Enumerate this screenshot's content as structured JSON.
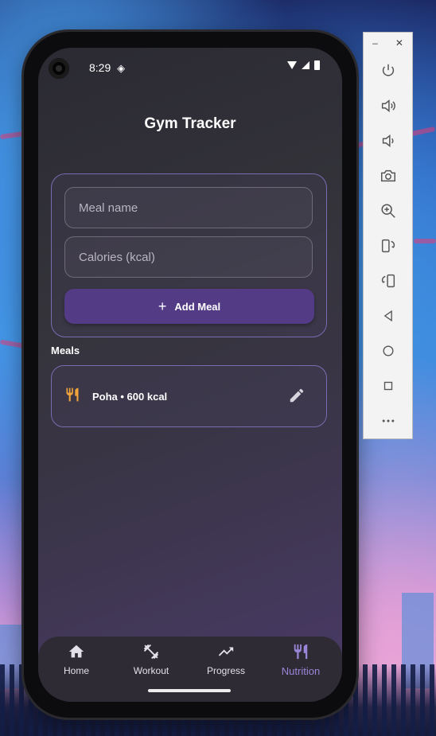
{
  "status_bar": {
    "time": "8:29"
  },
  "app": {
    "title": "Gym Tracker"
  },
  "form": {
    "meal_name_placeholder": "Meal name",
    "calories_placeholder": "Calories (kcal)",
    "add_button_label": "Add Meal"
  },
  "meals": {
    "heading": "Meals",
    "items": [
      {
        "label": "Poha • 600 kcal"
      }
    ]
  },
  "nav": {
    "items": [
      {
        "label": "Home",
        "icon": "home-icon"
      },
      {
        "label": "Workout",
        "icon": "dumbbell-icon"
      },
      {
        "label": "Progress",
        "icon": "trending-up-icon"
      },
      {
        "label": "Nutrition",
        "icon": "restaurant-icon",
        "active": true
      }
    ]
  },
  "emulator_toolbar": {
    "buttons": [
      "power-icon",
      "volume-up-icon",
      "volume-down-icon",
      "camera-icon",
      "zoom-in-icon",
      "rotate-left-icon",
      "rotate-right-icon",
      "back-icon",
      "home-circle-icon",
      "overview-icon",
      "more-icon"
    ]
  },
  "colors": {
    "accent": "#533c85",
    "active_nav": "#9a86d8",
    "meal_icon": "#f0a43a",
    "card_border": "#7b6bb0"
  }
}
